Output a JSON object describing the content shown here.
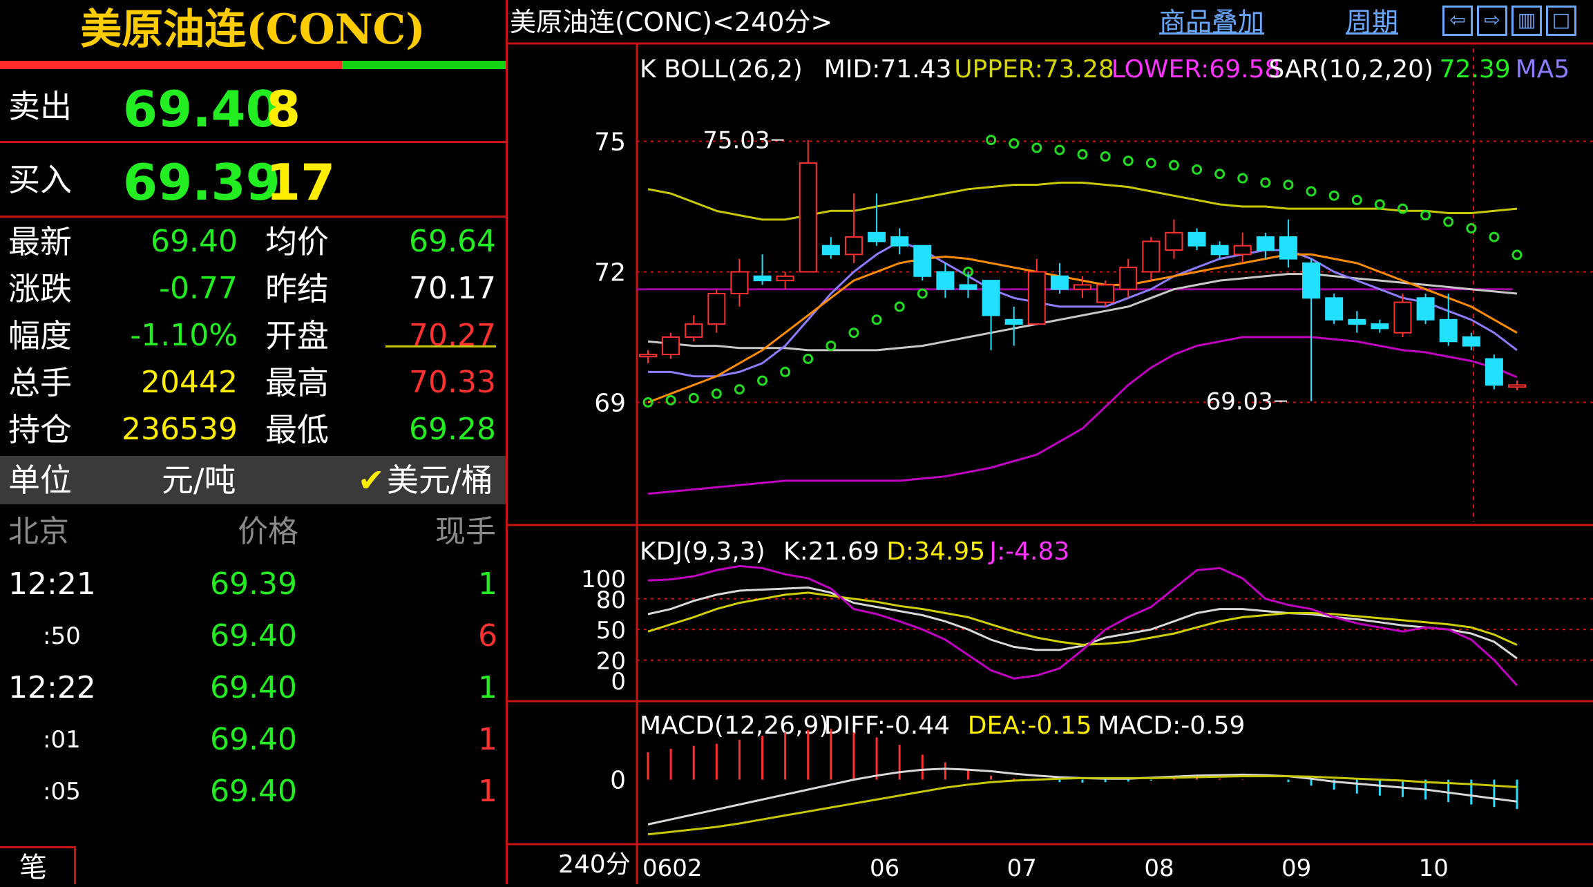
{
  "quote": {
    "title": "美原油连(CONC)",
    "sell_label": "卖出",
    "sell_price": "69.40",
    "sell_qty": "8",
    "buy_label": "买入",
    "buy_price": "69.39",
    "buy_qty": "17",
    "stats": [
      {
        "label": "最新",
        "value": "69.40",
        "color": "#22ee22"
      },
      {
        "label": "涨跌",
        "value": "-0.77",
        "color": "#22ee22"
      },
      {
        "label": "幅度",
        "value": "-1.10%",
        "color": "#22ee22"
      },
      {
        "label": "总手",
        "value": "20442",
        "color": "#ffee00"
      },
      {
        "label": "持仓",
        "value": "236539",
        "color": "#ffee00"
      }
    ],
    "stats2": [
      {
        "label": "均价",
        "value": "69.64",
        "color": "#22ee22"
      },
      {
        "label": "昨结",
        "value": "70.17",
        "color": "#ffffff"
      },
      {
        "label": "开盘",
        "value": "70.27",
        "color": "#ff3030"
      },
      {
        "label": "最高",
        "value": "70.33",
        "color": "#ff3030"
      },
      {
        "label": "最低",
        "value": "69.28",
        "color": "#22ee22"
      }
    ],
    "unit_label": "单位",
    "unit_cny": "元/吨",
    "unit_usd": "美元/桶",
    "check_mark": "✔",
    "ticks_head": {
      "time": "北京",
      "price": "价格",
      "vol": "现手"
    },
    "ticks": [
      {
        "time": "12:21",
        "price": "69.39",
        "vol": "1",
        "vol_color": "#22ee22",
        "small": false
      },
      {
        "time": ":50",
        "price": "69.40",
        "vol": "6",
        "vol_color": "#ff3030",
        "small": true
      },
      {
        "time": "12:22",
        "price": "69.40",
        "vol": "1",
        "vol_color": "#22ee22",
        "small": false
      },
      {
        "time": ":01",
        "price": "69.40",
        "vol": "1",
        "vol_color": "#ff3030",
        "small": true
      },
      {
        "time": ":05",
        "price": "69.40",
        "vol": "1",
        "vol_color": "#ff3030",
        "small": true
      }
    ],
    "bottom_tab": "笔"
  },
  "header": {
    "title": "美原油连(CONC)<240分>",
    "overlay_link": "商品叠加",
    "period_link": "周期",
    "icons": [
      "arrow-left-icon",
      "arrow-right-icon",
      "panel-icon",
      "window-icon"
    ]
  },
  "chart_data": [
    {
      "type": "candlestick",
      "title": "K  BOLL(26,2)",
      "legend": [
        {
          "text": "K  BOLL(26,2)",
          "color": "#ffffff"
        },
        {
          "text": "MID:71.43",
          "color": "#ffffff"
        },
        {
          "text": "UPPER:73.28",
          "color": "#d6d600"
        },
        {
          "text": "LOWER:69.58",
          "color": "#ff33ff"
        },
        {
          "text": "SAR(10,2,20)",
          "color": "#ffffff"
        },
        {
          "text": "72.39",
          "color": "#22ee22"
        },
        {
          "text": "MA5",
          "color": "#8c7cff"
        }
      ],
      "yticks": [
        "75",
        "72",
        "69"
      ],
      "ylim": [
        66.5,
        76.5
      ],
      "annotations": [
        {
          "text": "75.03",
          "x": 6,
          "y": 75.03
        },
        {
          "text": "69.03",
          "x": 28,
          "y": 69.03
        }
      ],
      "xticks": [
        {
          "label": "0602",
          "index": 0
        },
        {
          "label": "06",
          "index": 10
        },
        {
          "label": "07",
          "index": 16
        },
        {
          "label": "08",
          "index": 22
        },
        {
          "label": "09",
          "index": 28
        },
        {
          "label": "10",
          "index": 34
        }
      ],
      "candles": [
        [
          70.1,
          70.2,
          69.9,
          70.1
        ],
        [
          70.1,
          70.6,
          70.0,
          70.5
        ],
        [
          70.5,
          71.0,
          70.4,
          70.8
        ],
        [
          70.8,
          71.6,
          70.6,
          71.5
        ],
        [
          71.5,
          72.3,
          71.2,
          72.0
        ],
        [
          71.9,
          72.4,
          71.7,
          71.8
        ],
        [
          71.8,
          72.0,
          71.6,
          71.9
        ],
        [
          72.0,
          75.03,
          72.0,
          74.5
        ],
        [
          72.6,
          72.8,
          72.3,
          72.4
        ],
        [
          72.4,
          73.8,
          72.2,
          72.8
        ],
        [
          72.9,
          73.8,
          72.6,
          72.7
        ],
        [
          72.8,
          73.0,
          72.4,
          72.6
        ],
        [
          72.6,
          72.6,
          71.8,
          71.9
        ],
        [
          72.0,
          72.2,
          71.4,
          71.6
        ],
        [
          71.7,
          72.0,
          71.4,
          71.6
        ],
        [
          71.8,
          71.8,
          70.2,
          71.0
        ],
        [
          70.9,
          71.2,
          70.3,
          70.8
        ],
        [
          70.8,
          72.3,
          70.8,
          72.0
        ],
        [
          71.9,
          72.2,
          71.5,
          71.6
        ],
        [
          71.6,
          71.9,
          71.4,
          71.7
        ],
        [
          71.3,
          71.8,
          71.2,
          71.7
        ],
        [
          71.6,
          72.3,
          71.4,
          72.1
        ],
        [
          72.0,
          72.8,
          71.8,
          72.7
        ],
        [
          72.5,
          73.2,
          72.3,
          72.9
        ],
        [
          72.9,
          73.0,
          72.5,
          72.6
        ],
        [
          72.6,
          72.7,
          72.3,
          72.4
        ],
        [
          72.4,
          72.9,
          72.2,
          72.6
        ],
        [
          72.8,
          72.9,
          72.3,
          72.5
        ],
        [
          72.8,
          73.2,
          72.1,
          72.3
        ],
        [
          72.2,
          72.3,
          69.03,
          71.4
        ],
        [
          71.4,
          71.5,
          70.8,
          70.9
        ],
        [
          70.9,
          71.1,
          70.6,
          70.8
        ],
        [
          70.8,
          70.9,
          70.6,
          70.7
        ],
        [
          70.6,
          71.5,
          70.5,
          71.3
        ],
        [
          71.4,
          71.5,
          70.8,
          70.9
        ],
        [
          70.9,
          71.5,
          70.3,
          70.4
        ],
        [
          70.5,
          70.6,
          70.2,
          70.3
        ],
        [
          70.0,
          70.1,
          69.3,
          69.4
        ],
        [
          69.4,
          69.5,
          69.28,
          69.4
        ]
      ],
      "series": [
        {
          "name": "UPPER",
          "color": "#c8c800",
          "values": [
            73.9,
            73.8,
            73.6,
            73.4,
            73.3,
            73.2,
            73.2,
            73.3,
            73.4,
            73.4,
            73.5,
            73.6,
            73.7,
            73.8,
            73.9,
            73.95,
            74.0,
            74.0,
            74.05,
            74.05,
            74.0,
            73.95,
            73.85,
            73.75,
            73.65,
            73.55,
            73.5,
            73.5,
            73.45,
            73.45,
            73.45,
            73.45,
            73.45,
            73.4,
            73.4,
            73.35,
            73.35,
            73.4,
            73.45
          ]
        },
        {
          "name": "MID",
          "color": "#c8c8c8",
          "values": [
            70.4,
            70.35,
            70.3,
            70.3,
            70.25,
            70.25,
            70.25,
            70.2,
            70.2,
            70.2,
            70.2,
            70.25,
            70.3,
            70.4,
            70.5,
            70.6,
            70.7,
            70.8,
            70.9,
            71.0,
            71.1,
            71.2,
            71.4,
            71.6,
            71.7,
            71.8,
            71.85,
            71.9,
            71.95,
            71.95,
            71.9,
            71.85,
            71.8,
            71.75,
            71.7,
            71.65,
            71.6,
            71.55,
            71.5
          ]
        },
        {
          "name": "LOWER",
          "color": "#c000c0",
          "values": [
            66.9,
            66.95,
            67.0,
            67.05,
            67.1,
            67.15,
            67.2,
            67.2,
            67.2,
            67.2,
            67.2,
            67.2,
            67.25,
            67.3,
            67.4,
            67.5,
            67.65,
            67.8,
            68.1,
            68.4,
            68.9,
            69.4,
            69.8,
            70.1,
            70.3,
            70.4,
            70.5,
            70.5,
            70.5,
            70.5,
            70.45,
            70.4,
            70.3,
            70.2,
            70.15,
            70.05,
            69.95,
            69.8,
            69.58
          ]
        },
        {
          "name": "MA5",
          "color": "#8c7cff",
          "values": [
            69.7,
            69.7,
            69.6,
            69.6,
            69.7,
            69.9,
            70.3,
            70.9,
            71.5,
            72.0,
            72.4,
            72.7,
            72.5,
            72.2,
            71.9,
            71.6,
            71.4,
            71.3,
            71.2,
            71.2,
            71.2,
            71.4,
            71.6,
            71.9,
            72.1,
            72.3,
            72.4,
            72.5,
            72.5,
            72.3,
            72.0,
            71.8,
            71.6,
            71.4,
            71.3,
            71.1,
            70.9,
            70.6,
            70.2
          ]
        },
        {
          "name": "MA10",
          "color": "#ff8c00",
          "values": [
            69.0,
            69.2,
            69.4,
            69.6,
            69.9,
            70.2,
            70.6,
            71.0,
            71.4,
            71.8,
            72.0,
            72.2,
            72.3,
            72.35,
            72.3,
            72.2,
            72.1,
            72.0,
            71.9,
            71.8,
            71.7,
            71.7,
            71.8,
            71.9,
            72.0,
            72.1,
            72.2,
            72.3,
            72.4,
            72.4,
            72.3,
            72.2,
            72.0,
            71.8,
            71.6,
            71.4,
            71.2,
            70.9,
            70.6
          ]
        }
      ],
      "sar": [
        69.0,
        69.05,
        69.1,
        69.2,
        69.3,
        69.5,
        69.7,
        70.0,
        70.3,
        70.6,
        70.9,
        71.2,
        71.5,
        71.8,
        72.0,
        75.03,
        74.95,
        74.85,
        74.8,
        74.7,
        74.65,
        74.55,
        74.5,
        74.45,
        74.35,
        74.25,
        74.15,
        74.05,
        74.0,
        73.85,
        73.75,
        73.65,
        73.55,
        73.45,
        73.3,
        73.15,
        73.0,
        72.8,
        72.39
      ]
    },
    {
      "type": "line",
      "title": "KDJ(9,3,3)",
      "legend": [
        {
          "text": "KDJ(9,3,3)",
          "color": "#ffffff"
        },
        {
          "text": "K:21.69",
          "color": "#ffffff"
        },
        {
          "text": "D:34.95",
          "color": "#ffee00"
        },
        {
          "text": "J:-4.83",
          "color": "#ff33ff"
        }
      ],
      "yticks": [
        "100",
        "80",
        "50",
        "20",
        "0"
      ],
      "ylim": [
        -10,
        115
      ],
      "series": [
        {
          "name": "K",
          "color": "#d8d8d8",
          "values": [
            65,
            70,
            78,
            84,
            88,
            89,
            90,
            91,
            86,
            76,
            72,
            68,
            64,
            58,
            50,
            40,
            33,
            30,
            30,
            34,
            42,
            46,
            50,
            58,
            66,
            70,
            70,
            68,
            66,
            65,
            62,
            60,
            57,
            54,
            52,
            50,
            46,
            38,
            21.69
          ]
        },
        {
          "name": "D",
          "color": "#d0d000",
          "values": [
            48,
            55,
            62,
            70,
            76,
            80,
            84,
            86,
            83,
            80,
            77,
            73,
            70,
            66,
            62,
            55,
            48,
            42,
            38,
            35,
            36,
            38,
            42,
            46,
            52,
            58,
            62,
            64,
            66,
            66,
            65,
            63,
            61,
            59,
            57,
            55,
            52,
            45,
            34.95
          ]
        },
        {
          "name": "J",
          "color": "#c000c0",
          "values": [
            98,
            99,
            102,
            108,
            112,
            110,
            104,
            100,
            90,
            70,
            65,
            58,
            50,
            40,
            25,
            10,
            2,
            5,
            12,
            30,
            50,
            62,
            72,
            90,
            108,
            110,
            100,
            80,
            74,
            70,
            62,
            56,
            52,
            48,
            52,
            50,
            40,
            20,
            -4.83
          ]
        }
      ]
    },
    {
      "type": "bar",
      "title": "MACD(12,26,9)",
      "legend": [
        {
          "text": "MACD(12,26,9)",
          "color": "#ffffff"
        },
        {
          "text": "DIFF:-0.44",
          "color": "#ffffff"
        },
        {
          "text": "DEA:-0.15",
          "color": "#ffee00"
        },
        {
          "text": "MACD:-0.59",
          "color": "#ffffff"
        }
      ],
      "yticks": [
        "0"
      ],
      "ylim": [
        -1.2,
        1.3
      ],
      "hist": [
        0.55,
        0.62,
        0.68,
        0.72,
        0.8,
        0.88,
        0.95,
        1.0,
        1.02,
        0.95,
        0.85,
        0.7,
        0.5,
        0.35,
        0.2,
        0.08,
        0.02,
        -0.02,
        -0.05,
        -0.06,
        -0.05,
        -0.04,
        -0.02,
        0.02,
        0.03,
        0.02,
        0.01,
        0.0,
        -0.05,
        -0.12,
        -0.2,
        -0.28,
        -0.32,
        -0.35,
        -0.4,
        -0.45,
        -0.5,
        -0.55,
        -0.59
      ],
      "series": [
        {
          "name": "DIFF",
          "color": "#d8d8d8",
          "values": [
            -0.9,
            -0.8,
            -0.7,
            -0.6,
            -0.5,
            -0.4,
            -0.3,
            -0.2,
            -0.1,
            0.0,
            0.08,
            0.15,
            0.2,
            0.22,
            0.2,
            0.17,
            0.12,
            0.08,
            0.05,
            0.03,
            0.02,
            0.02,
            0.04,
            0.06,
            0.08,
            0.09,
            0.1,
            0.09,
            0.07,
            0.02,
            -0.04,
            -0.08,
            -0.12,
            -0.16,
            -0.2,
            -0.26,
            -0.32,
            -0.38,
            -0.44
          ]
        },
        {
          "name": "DEA",
          "color": "#c8c800",
          "values": [
            -1.1,
            -1.05,
            -1.0,
            -0.95,
            -0.88,
            -0.8,
            -0.72,
            -0.64,
            -0.56,
            -0.48,
            -0.4,
            -0.32,
            -0.24,
            -0.16,
            -0.1,
            -0.05,
            -0.02,
            0.0,
            0.02,
            0.03,
            0.03,
            0.03,
            0.03,
            0.04,
            0.05,
            0.06,
            0.07,
            0.07,
            0.07,
            0.06,
            0.04,
            0.02,
            0.0,
            -0.02,
            -0.05,
            -0.07,
            -0.09,
            -0.12,
            -0.15
          ]
        }
      ]
    }
  ],
  "footer": {
    "period": "240分"
  }
}
